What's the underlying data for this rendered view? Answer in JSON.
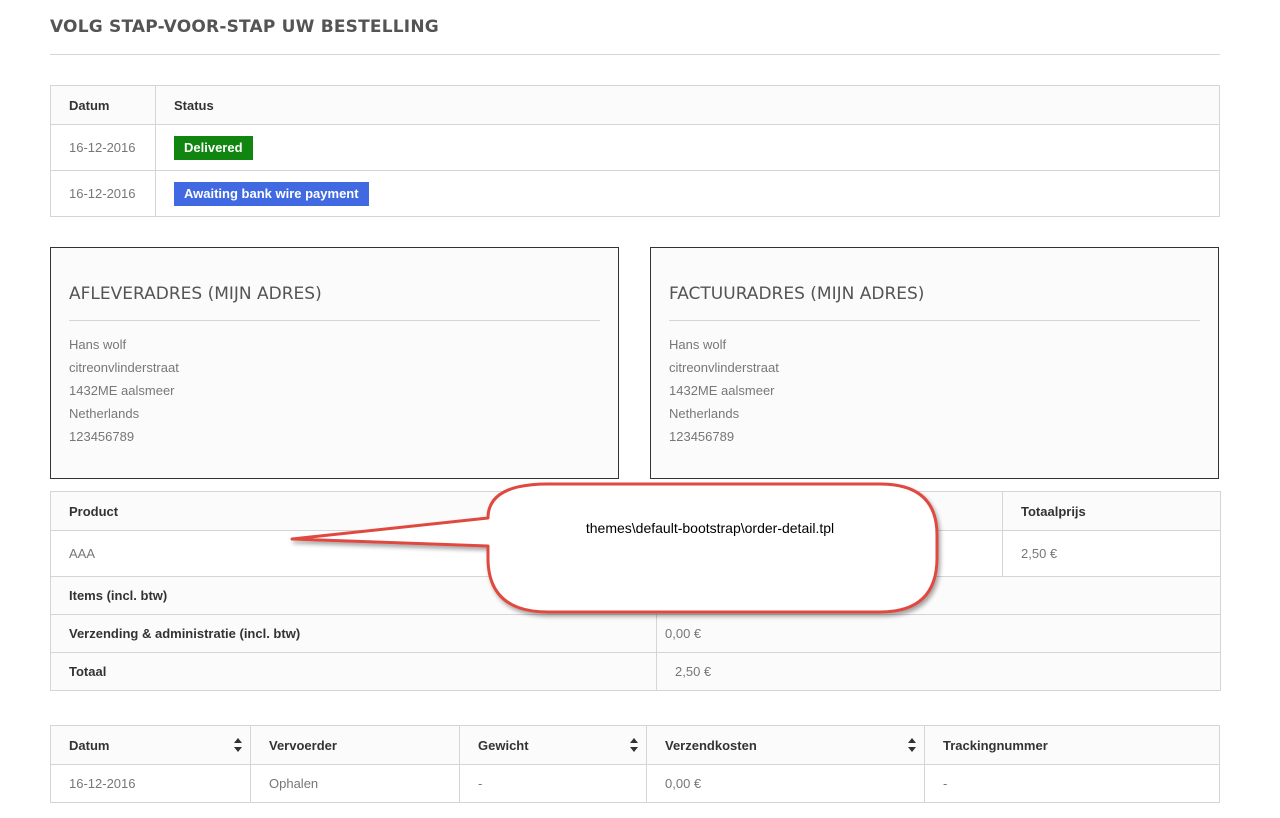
{
  "page": {
    "title": "VOLG STAP-VOOR-STAP UW BESTELLING"
  },
  "status_table": {
    "headers": {
      "date": "Datum",
      "status": "Status"
    },
    "rows": [
      {
        "date": "16-12-2016",
        "status": "Delivered",
        "status_color": "#108510"
      },
      {
        "date": "16-12-2016",
        "status": "Awaiting bank wire payment",
        "status_color": "#4169e1"
      }
    ]
  },
  "delivery_address": {
    "title": "AFLEVERADRES (MIJN ADRES)",
    "lines": [
      "Hans wolf",
      "citreonvlinderstraat",
      "1432ME aalsmeer",
      "Netherlands",
      "123456789"
    ]
  },
  "invoice_address": {
    "title": "FACTUURADRES (MIJN ADRES)",
    "lines": [
      "Hans wolf",
      "citreonvlinderstraat",
      "1432ME aalsmeer",
      "Netherlands",
      "123456789"
    ]
  },
  "product_table": {
    "headers": {
      "product": "Product",
      "total_price": "Totaalprijs"
    },
    "rows": [
      {
        "product": "AAA",
        "total_price": "2,50 €"
      }
    ],
    "summary": [
      {
        "label": "Items (incl. btw)",
        "value": ""
      },
      {
        "label": "Verzending & administratie (incl. btw)",
        "value": "0,00 €"
      },
      {
        "label": "Totaal",
        "value": "2,50 €"
      }
    ]
  },
  "shipping_table": {
    "headers": {
      "date": "Datum",
      "carrier": "Vervoerder",
      "weight": "Gewicht",
      "shipping_cost": "Verzendkosten",
      "tracking": "Trackingnummer"
    },
    "rows": [
      {
        "date": "16-12-2016",
        "carrier": "Ophalen",
        "weight": "-",
        "shipping_cost": "0,00 €",
        "tracking": "-"
      }
    ]
  },
  "annotation": {
    "text": "themes\\default-bootstrap\\order-detail.tpl",
    "stroke_color": "#e04a3f"
  },
  "colors": {
    "header_bg": "#fbfbfb",
    "border": "#d6d4d4",
    "text": "#777777",
    "heading": "#555454"
  }
}
